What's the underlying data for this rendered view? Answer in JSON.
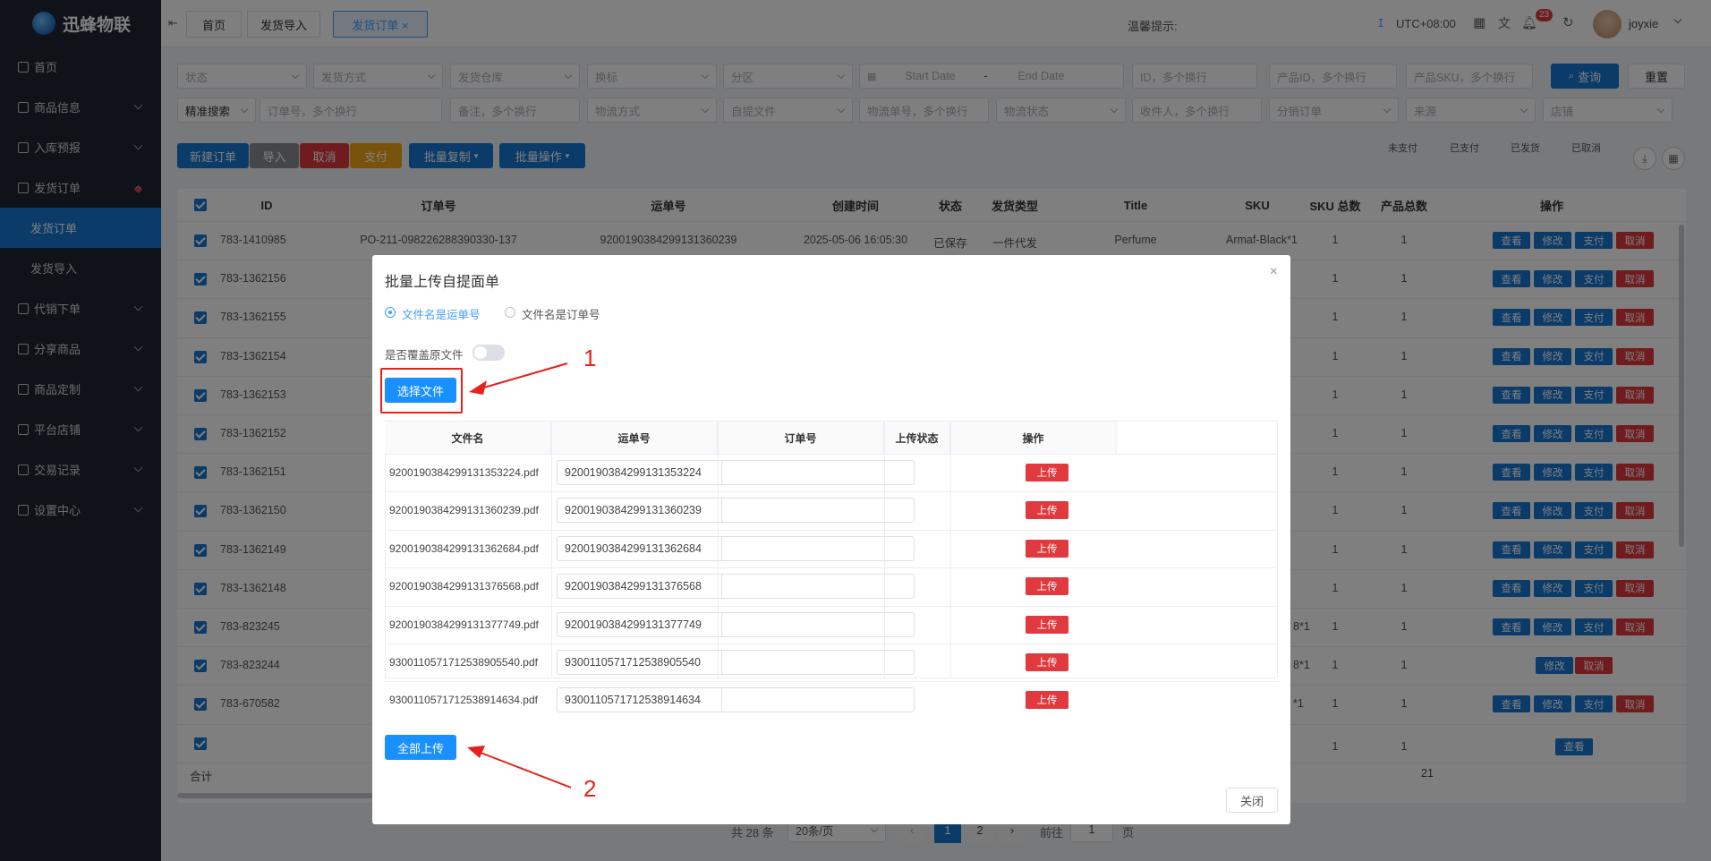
{
  "app": {
    "name": "迅蜂物联"
  },
  "sidebar": {
    "items": [
      {
        "label": "首页",
        "chev": ""
      },
      {
        "label": "商品信息",
        "chev": "down"
      },
      {
        "label": "入库预报",
        "chev": "down"
      },
      {
        "label": "发货订单",
        "chev": "up"
      },
      {
        "label": "发货订单",
        "sub": true,
        "active": true
      },
      {
        "label": "发货导入",
        "sub": true
      },
      {
        "label": "代销下单",
        "chev": "down"
      },
      {
        "label": "分享商品",
        "chev": "down"
      },
      {
        "label": "商品定制",
        "chev": "down"
      },
      {
        "label": "平台店铺",
        "chev": "down"
      },
      {
        "label": "交易记录",
        "chev": "down"
      },
      {
        "label": "设置中心",
        "chev": "down"
      }
    ]
  },
  "header": {
    "tabs": [
      "首页",
      "发货导入",
      "发货订单 ×"
    ],
    "tip": "温馨提示:",
    "timezone": "UTC+08:00",
    "badge": "23",
    "user": "joyxie"
  },
  "filters": {
    "row1": [
      "状态",
      "发货方式",
      "发货仓库",
      "换标",
      "分区"
    ],
    "start_date": "Start Date",
    "date_sep": "-",
    "end_date": "End Date",
    "row1b": [
      "ID，多个换行",
      "产品ID，多个换行",
      "产品SKU，多个换行"
    ],
    "query": "查询",
    "reset": "重置",
    "row2": [
      "精准搜索",
      "订单号，多个换行",
      "备注，多个换行",
      "物流方式",
      "自提文件",
      "物流单号，多个换行",
      "物流状态",
      "收件人，多个换行",
      "分销订单",
      "来源",
      "店铺"
    ]
  },
  "actions": {
    "new_order": "新建订单",
    "import": "导入",
    "cancel": "取消",
    "pay": "支付",
    "batch_copy": "批量复制",
    "batch_ops": "批量操作"
  },
  "summary": [
    "未支付",
    "已支付",
    "已发货",
    "已取消"
  ],
  "table": {
    "headers": [
      "ID",
      "订单号",
      "运单号",
      "创建时间",
      "状态",
      "发货类型",
      "Title",
      "SKU",
      "SKU 总数",
      "产品总数",
      "操作"
    ],
    "first_row": {
      "id": "783-1410985",
      "order": "PO-211-098226288390330-137",
      "tracking": "9200190384299131360239",
      "created": "2025-05-06 16:05:30",
      "status": "已保存",
      "ship_type": "一件代发",
      "title": "Perfume",
      "sku": "Armaf-Black*1",
      "sku_total": "1",
      "product_total": "1"
    },
    "ids": [
      "783-1362156",
      "783-1362155",
      "783-1362154",
      "783-1362153",
      "783-1362152",
      "783-1362151",
      "783-1362150",
      "783-1362149",
      "783-1362148",
      "783-823245",
      "783-823244",
      "783-670582"
    ],
    "sku_tail": [
      "8*1",
      "8*1",
      "*1"
    ],
    "op_labels": {
      "view": "查看",
      "edit": "修改",
      "pay": "支付",
      "cancel": "取消"
    },
    "total_label": "合计",
    "total_value": "21",
    "qty": "1"
  },
  "pagination": {
    "total": "共 28 条",
    "per_page": "20条/页",
    "pages": [
      "1",
      "2"
    ],
    "goto_label": "前往",
    "goto_value": "1",
    "page_suffix": "页"
  },
  "modal": {
    "title": "批量上传自提面单",
    "radio1": "文件名是运单号",
    "radio2": "文件名是订单号",
    "overwrite_label": "是否覆盖原文件",
    "choose_file": "选择文件",
    "headers": [
      "文件名",
      "运单号",
      "订单号",
      "上传状态",
      "操作"
    ],
    "rows": [
      {
        "file": "9200190384299131353224.pdf",
        "tracking": "9200190384299131353224"
      },
      {
        "file": "9200190384299131360239.pdf",
        "tracking": "9200190384299131360239"
      },
      {
        "file": "9200190384299131362684.pdf",
        "tracking": "9200190384299131362684"
      },
      {
        "file": "9200190384299131376568.pdf",
        "tracking": "9200190384299131376568"
      },
      {
        "file": "9200190384299131377749.pdf",
        "tracking": "9200190384299131377749"
      },
      {
        "file": "9300110571712538905540.pdf",
        "tracking": "9300110571712538905540"
      },
      {
        "file": "9300110571712538914634.pdf",
        "tracking": "9300110571712538914634"
      }
    ],
    "upload_label": "上传",
    "upload_all": "全部上传",
    "close": "关闭"
  },
  "annotations": {
    "step1": "1",
    "step2": "2"
  },
  "colors": {
    "primary": "#1677d2",
    "danger": "#e0393e",
    "warning": "#f3a417",
    "annotation": "#e5231c"
  }
}
